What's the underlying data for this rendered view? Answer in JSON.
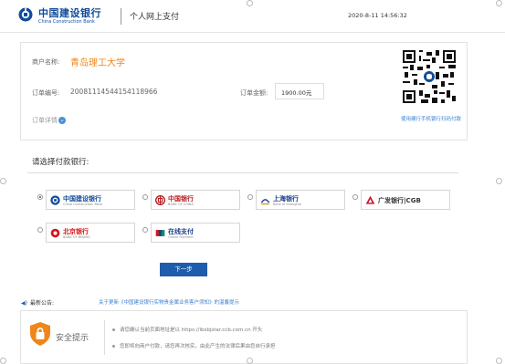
{
  "header": {
    "bank_name": "中国建设银行",
    "bank_name_en": "China Construction Bank",
    "page_title": "个人网上支付",
    "datetime": "2020-8-11 14:56:32"
  },
  "order": {
    "merchant_label": "商户名称:",
    "merchant_value": "青岛理工大学",
    "order_no_label": "订单编号:",
    "order_no_value": "20081114544154118966",
    "amount_label": "订单金额:",
    "amount_value": "1900.00元",
    "detail_label": "订单详情",
    "qr_caption": "使用建行手机银行扫码付款"
  },
  "bank_select": {
    "title": "请选择付款银行:",
    "banks": [
      {
        "name": "中国建设银行",
        "sub": "China Construction Bank",
        "color": "#0f4c9a",
        "selected": true
      },
      {
        "name": "中国银行",
        "sub": "BANK OF CHINA",
        "color": "#b81c22",
        "selected": false
      },
      {
        "name": "上海银行",
        "sub": "Bank of Shanghai",
        "color": "#1a3e8c",
        "selected": false
      },
      {
        "name": "广发银行|CGB",
        "sub": "",
        "color": "#c8102e",
        "selected": false
      },
      {
        "name": "北京银行",
        "sub": "BANK OF BEIJING",
        "color": "#d4161c",
        "selected": false
      },
      {
        "name": "在线支付",
        "sub": "Online Payment",
        "color": "#1d3f87",
        "selected": false
      }
    ],
    "next_button": "下一步"
  },
  "notice": {
    "heading": "最新公告:",
    "link_text": "关于更新《中国建设银行实物贵金属业务客户须知》的温馨提示"
  },
  "security": {
    "title": "安全提示",
    "tips": [
      "请您确认当前页面地址是以 https://ibsbjstar.ccb.com.cn 开头",
      "您即将向商户付款，请您再次核实，由此产生的法律后果由您自行承担"
    ]
  },
  "colors": {
    "brand_blue": "#0f4c9a",
    "merchant_orange": "#f08519",
    "link_blue": "#3b7fd0",
    "button_blue": "#1e5cad"
  }
}
